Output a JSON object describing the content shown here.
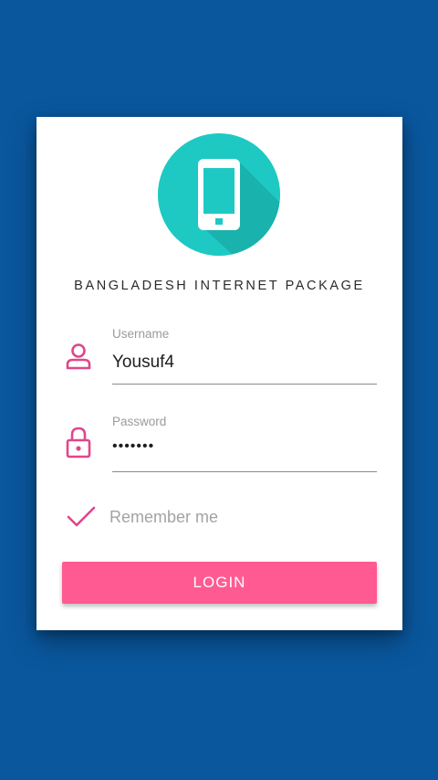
{
  "app": {
    "title": "BANGLADESH INTERNET PACKAGE",
    "logo_icon": "smartphone-icon"
  },
  "form": {
    "username": {
      "label": "Username",
      "value": "Yousuf4",
      "icon": "person-icon"
    },
    "password": {
      "label": "Password",
      "value": "•••••••",
      "icon": "lock-icon"
    },
    "remember": {
      "label": "Remember me",
      "checked": true,
      "icon": "checkmark-icon"
    },
    "login_label": "LOGIN"
  },
  "colors": {
    "background": "#0a579e",
    "accent": "#ff5a91",
    "icon_pink": "#e0468a",
    "logo_circle": "#1ec9c3",
    "logo_shadow": "#169f9a"
  }
}
